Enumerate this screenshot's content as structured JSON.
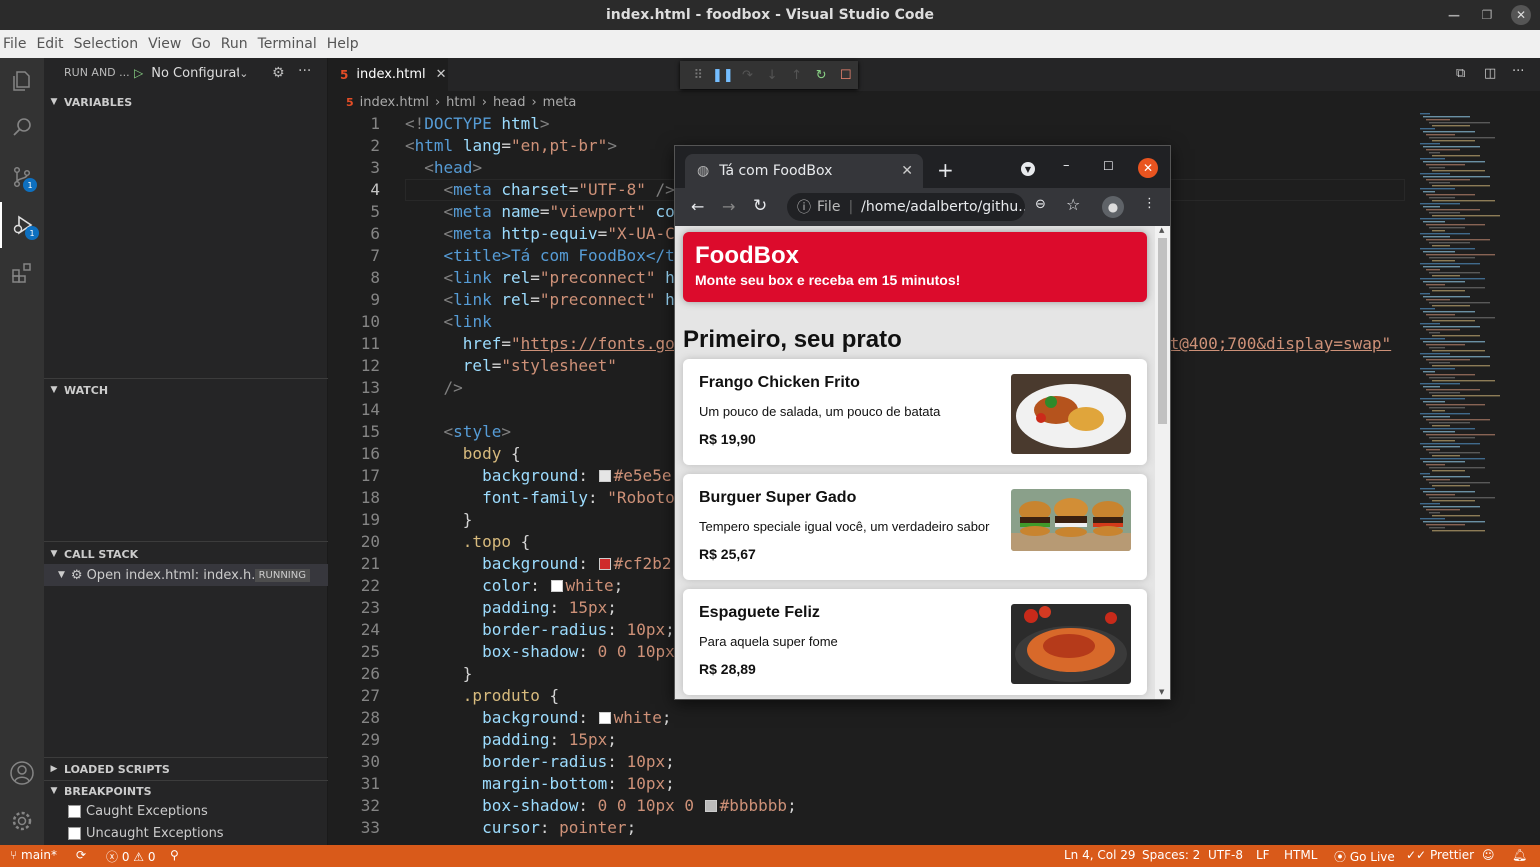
{
  "window": {
    "title": "index.html - foodbox - Visual Studio Code"
  },
  "menu": [
    "File",
    "Edit",
    "Selection",
    "View",
    "Go",
    "Run",
    "Terminal",
    "Help"
  ],
  "activity": {
    "scm_badge": "1",
    "debug_badge": "1"
  },
  "sidebar": {
    "title": "RUN AND ...",
    "config": "No Configurat",
    "sections": {
      "variables": "VARIABLES",
      "watch": "WATCH",
      "callstack": "CALL STACK",
      "loaded": "LOADED SCRIPTS",
      "breakpoints": "BREAKPOINTS"
    },
    "callstack_item": "Open index.html: index.h...",
    "callstack_status": "RUNNING",
    "breakpoints": [
      "Caught Exceptions",
      "Uncaught Exceptions"
    ]
  },
  "editor": {
    "tab": "index.html",
    "breadcrumb": [
      "index.html",
      "html",
      "head",
      "meta"
    ],
    "line_numbers": [
      "1",
      "2",
      "3",
      "4",
      "5",
      "6",
      "7",
      "8",
      "9",
      "10",
      "11",
      "12",
      "13",
      "14",
      "15",
      "16",
      "17",
      "18",
      "19",
      "20",
      "21",
      "22",
      "23",
      "24",
      "25",
      "26",
      "27",
      "28",
      "29",
      "30",
      "31",
      "32",
      "33"
    ],
    "overflow": {
      "l5": "co",
      "l6": "X-UA-C",
      "l7": "<title>Tá com FoodBox</t",
      "l8": "h",
      "l9": "h",
      "l11a": "https://fonts.go",
      "l11b": "nt@400;700&display=swap\"",
      "l17": "#e5e5e",
      "l18": "\"Roboto",
      "l21": "#cf2b2",
      "l25": "0 0 10px"
    }
  },
  "browser": {
    "tab_title": "Tá com FoodBox",
    "url_scheme": "File",
    "url": "/home/adalberto/githu...",
    "site": {
      "title": "FoodBox",
      "subtitle": "Monte seu box e receba em 15 minutos!",
      "section": "Primeiro, seu prato",
      "products": [
        {
          "name": "Frango Chicken Frito",
          "desc": "Um pouco de salada, um pouco de batata",
          "price": "R$ 19,90"
        },
        {
          "name": "Burguer Super Gado",
          "desc": "Tempero speciale igual você, um verdadeiro sabor",
          "price": "R$ 25,67"
        },
        {
          "name": "Espaguete Feliz",
          "desc": "Para aquela super fome",
          "price": "R$ 28,89"
        }
      ]
    }
  },
  "status": {
    "branch": "main*",
    "errors": "0",
    "warnings": "0",
    "position": "Ln 4, Col 29",
    "spaces": "Spaces: 2",
    "encoding": "UTF-8",
    "eol": "LF",
    "language": "HTML",
    "golive": "Go Live",
    "prettier": "Prettier"
  },
  "colors": {
    "status": "#d95a1a",
    "brand": "#dc0b2c",
    "activity": "#333333"
  }
}
